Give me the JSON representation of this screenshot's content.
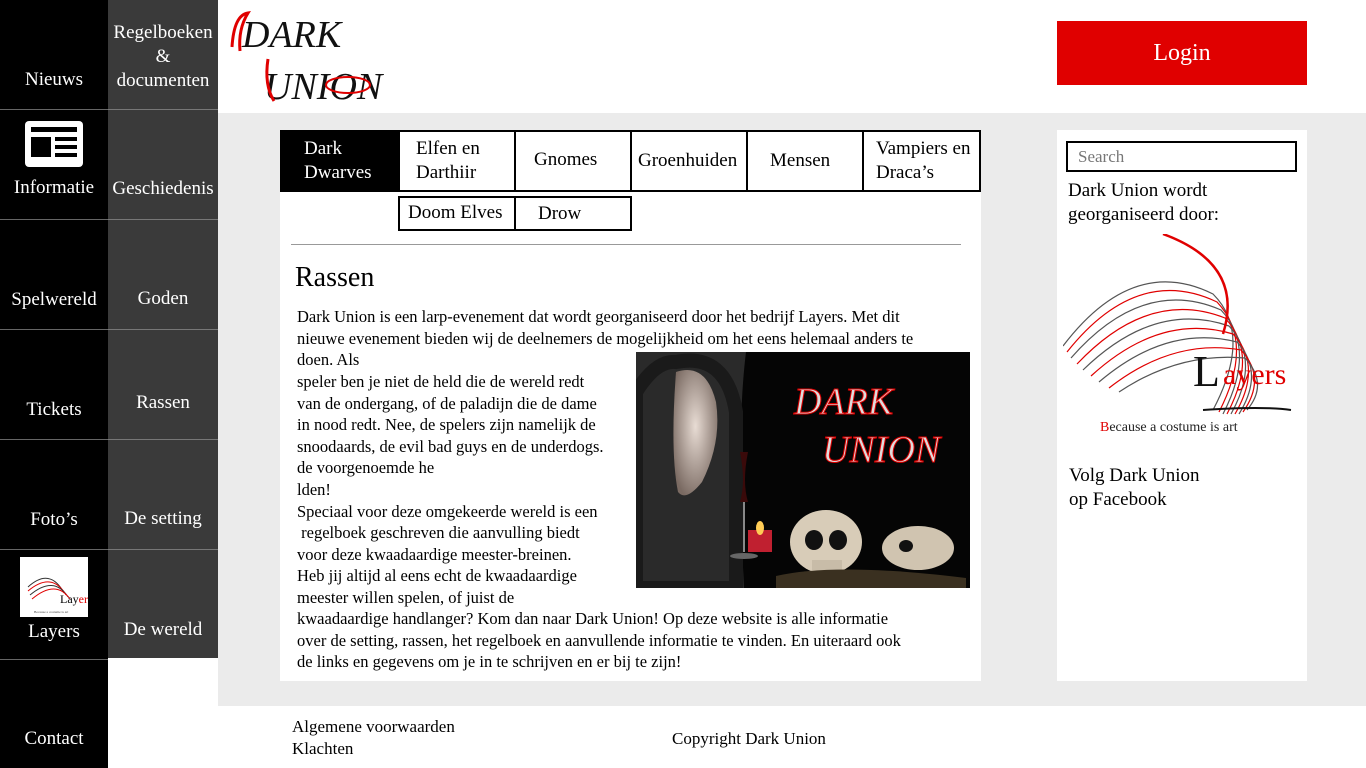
{
  "nav_primary": [
    {
      "label": "Nieuws"
    },
    {
      "label": "Informatie"
    },
    {
      "label": "Spelwereld"
    },
    {
      "label": "Tickets"
    },
    {
      "label": "Foto’s"
    },
    {
      "label": "Layers"
    },
    {
      "label": "Contact"
    }
  ],
  "nav_secondary": [
    {
      "label": "Regelboeken & documenten"
    },
    {
      "label": "Geschiedenis"
    },
    {
      "label": "Goden"
    },
    {
      "label": "Rassen"
    },
    {
      "label": "De setting"
    },
    {
      "label": "De wereld"
    }
  ],
  "header": {
    "logo_line1": "DARK",
    "logo_line2": "UNION",
    "login_label": "Login"
  },
  "tabs": [
    {
      "label": "Dark Dwarves"
    },
    {
      "label": "Elfen en Darthiir"
    },
    {
      "label": "Gnomes"
    },
    {
      "label": "Groenhuiden"
    },
    {
      "label": "Mensen"
    },
    {
      "label": "Vampiers en Draca’s"
    },
    {
      "label": "Doom Elves"
    },
    {
      "label": "Drow"
    }
  ],
  "content": {
    "heading": "Rassen",
    "lines_full_top": [
      "Dark Union is een larp-evenement dat wordt georganiseerd door het bedrijf Layers. Met dit",
      "nieuwe evenement bieden wij de deelnemers de mogelijkheid om het eens helemaal anders te",
      "doen. Als"
    ],
    "lines_wrapped": [
      "speler ben je niet de held die de wereld redt",
      "van de ondergang, of de paladijn die de dame",
      "in nood redt. Nee, de spelers zijn namelijk de",
      "snoodaards, de evil bad guys en de underdogs.",
      "de voorgenoemde he",
      "lden!",
      "Speciaal voor deze omgekeerde wereld is een",
      " regelboek geschreven die aanvulling biedt",
      "voor deze kwaadaardige meester-breinen.",
      "Heb jij altijd al eens echt de kwaadaardige",
      "meester willen spelen, of juist de"
    ],
    "lines_full_bottom": [
      "kwaadaardige handlanger? Kom dan naar Dark Union! Op deze website is alle informatie",
      "over de setting, rassen, het regelboek en aanvullende informatie te vinden. En uiteraard ook",
      "de links en gegevens om je in te schrijven en er bij te zijn!"
    ],
    "image_logo_line1": "DARK",
    "image_logo_line2": "UNION"
  },
  "sidebar": {
    "search_placeholder": "Search",
    "organised_by": "Dark Union wordt georganiseerd door:",
    "layers_tagline_initial": "B",
    "layers_tagline_rest": "ecause a costume is art",
    "layers_logo_initial": "L",
    "layers_logo_rest": "ayers",
    "facebook_line1": "Volg Dark Union",
    "facebook_line2": "op Facebook"
  },
  "footer": {
    "terms": "Algemene voorwaarden",
    "complaints": "Klachten",
    "copyright": "Copyright Dark Union"
  },
  "colors": {
    "accent": "#e00000",
    "nav_primary_bg": "#000000",
    "nav_secondary_bg": "#3a3a3a",
    "band_bg": "#ebebeb"
  }
}
